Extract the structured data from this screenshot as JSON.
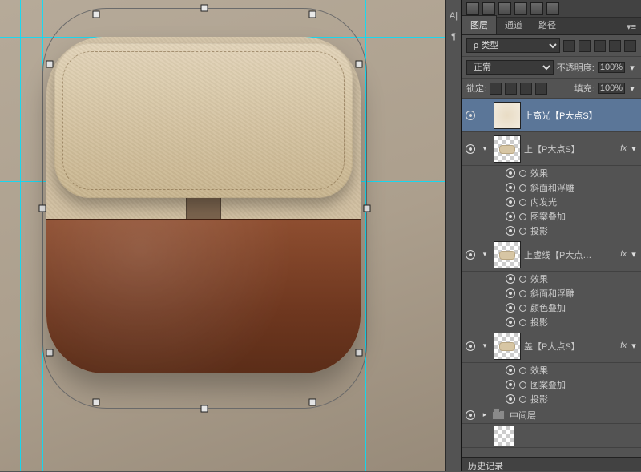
{
  "toolstrip": {
    "char": "A|"
  },
  "panel": {
    "tabs": {
      "layers": "图层",
      "channels": "通道",
      "paths": "路径",
      "menu": "▾≡"
    },
    "filters": {
      "kind": "ρ 类型",
      "blend": "正常",
      "opacity_label": "不透明度:",
      "opacity_value": "100%",
      "lock_label": "锁定:",
      "fill_label": "填充:",
      "fill_value": "100%"
    },
    "effects_label": "效果",
    "layers": [
      {
        "name": "上高光【P大点S】",
        "thumb": "cream",
        "selected": true
      },
      {
        "name": "上【P大点S】",
        "thumb": "chip",
        "fx": true,
        "sub": [
          "斜面和浮雕",
          "内发光",
          "图案叠加",
          "投影"
        ]
      },
      {
        "name": "上虚线【P大点…",
        "thumb": "chip",
        "fx": true,
        "sub": [
          "斜面和浮雕",
          "颜色叠加",
          "投影"
        ]
      },
      {
        "name": "盖【P大点S】",
        "thumb": "chip",
        "fx": true,
        "sub": [
          "图案叠加",
          "投影"
        ]
      }
    ],
    "group": "中间层"
  },
  "history": {
    "title": "历史记录"
  }
}
